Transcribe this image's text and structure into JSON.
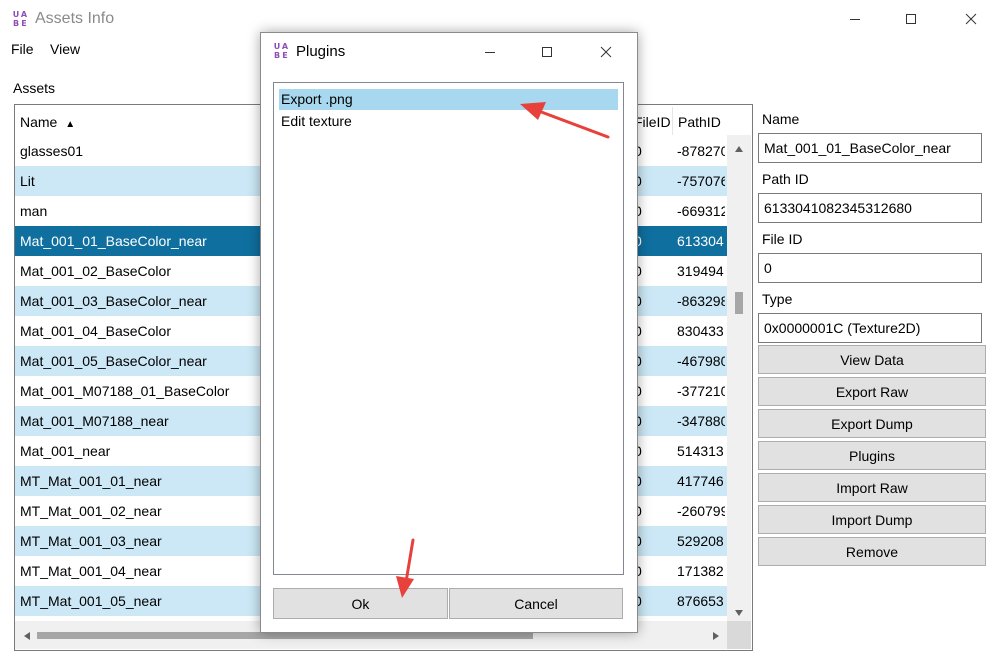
{
  "window": {
    "title": "Assets Info",
    "logo_letters": [
      "U",
      "A",
      "B",
      "E"
    ],
    "menu": [
      "File",
      "View"
    ]
  },
  "assets_label": "Assets",
  "table": {
    "columns": [
      "Name",
      "FileID",
      "PathID"
    ],
    "sort_indicator": "▲",
    "rows": [
      {
        "name": "glasses01",
        "file_id": "0",
        "path_id": "-878270"
      },
      {
        "name": "Lit",
        "file_id": "0",
        "path_id": "-757076"
      },
      {
        "name": "man",
        "file_id": "0",
        "path_id": "-669312"
      },
      {
        "name": "Mat_001_01_BaseColor_near",
        "file_id": "0",
        "path_id": "613304"
      },
      {
        "name": "Mat_001_02_BaseColor",
        "file_id": "0",
        "path_id": "319494"
      },
      {
        "name": "Mat_001_03_BaseColor_near",
        "file_id": "0",
        "path_id": "-863298"
      },
      {
        "name": "Mat_001_04_BaseColor",
        "file_id": "0",
        "path_id": "830433"
      },
      {
        "name": "Mat_001_05_BaseColor_near",
        "file_id": "0",
        "path_id": "-467980"
      },
      {
        "name": "Mat_001_M07188_01_BaseColor",
        "file_id": "0",
        "path_id": "-377210"
      },
      {
        "name": "Mat_001_M07188_near",
        "file_id": "0",
        "path_id": "-347880"
      },
      {
        "name": "Mat_001_near",
        "file_id": "0",
        "path_id": "514313"
      },
      {
        "name": "MT_Mat_001_01_near",
        "file_id": "0",
        "path_id": "417746"
      },
      {
        "name": "MT_Mat_001_02_near",
        "file_id": "0",
        "path_id": "-260799"
      },
      {
        "name": "MT_Mat_001_03_near",
        "file_id": "0",
        "path_id": "529208"
      },
      {
        "name": "MT_Mat_001_04_near",
        "file_id": "0",
        "path_id": "171382"
      },
      {
        "name": "MT_Mat_001_05_near",
        "file_id": "0",
        "path_id": "876653"
      }
    ],
    "selected_index": 3
  },
  "details": {
    "name_label": "Name",
    "name_value": "Mat_001_01_BaseColor_near",
    "pathid_label": "Path ID",
    "pathid_value": "6133041082345312680",
    "fileid_label": "File ID",
    "fileid_value": "0",
    "type_label": "Type",
    "type_value": "0x0000001C (Texture2D)",
    "buttons": [
      "View Data",
      "Export Raw",
      "Export Dump",
      "Plugins",
      "Import Raw",
      "Import Dump",
      "Remove"
    ]
  },
  "dialog": {
    "title": "Plugins",
    "items": [
      "Export .png",
      "Edit texture"
    ],
    "selected_index": 0,
    "ok_label": "Ok",
    "cancel_label": "Cancel"
  },
  "colors": {
    "selected_row": "#0f6f9e",
    "alt_row": "#cce8f6",
    "annotation_arrow": "#e8403a"
  }
}
